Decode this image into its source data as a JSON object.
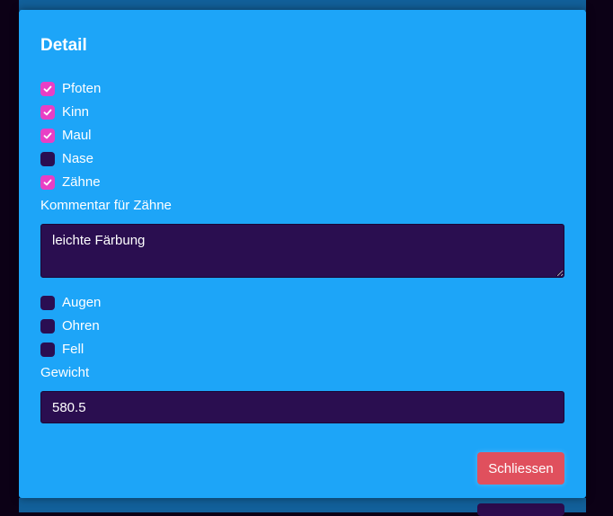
{
  "modal": {
    "title": "Detail",
    "close_label": "Schliessen"
  },
  "checks": [
    {
      "label": "Pfoten",
      "checked": true
    },
    {
      "label": "Kinn",
      "checked": true
    },
    {
      "label": "Maul",
      "checked": true
    },
    {
      "label": "Nase",
      "checked": false
    },
    {
      "label": "Zähne",
      "checked": true
    },
    {
      "label": "Augen",
      "checked": false
    },
    {
      "label": "Ohren",
      "checked": false
    },
    {
      "label": "Fell",
      "checked": false
    }
  ],
  "comment": {
    "label": "Kommentar für Zähne",
    "value": "leichte Färbung"
  },
  "weight": {
    "label": "Gewicht",
    "value": "580.5"
  },
  "colors": {
    "modal_bg": "#1da5f8",
    "checked": "#e83fc5",
    "unchecked": "#2a0e52",
    "input_bg": "#2a0e50",
    "close_button": "#e0505d"
  },
  "icons": {
    "check": "checkmark-icon"
  }
}
